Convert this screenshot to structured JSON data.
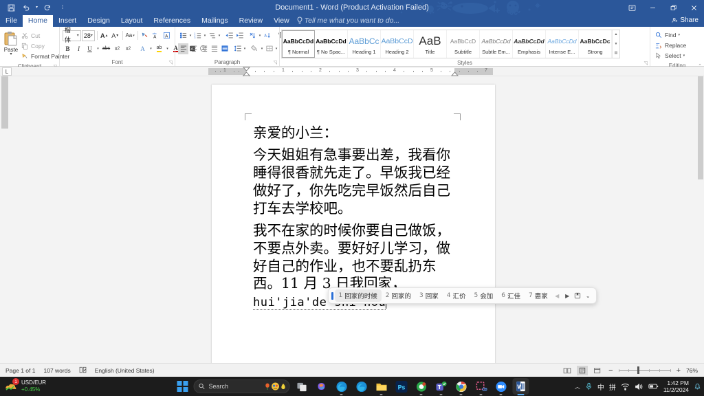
{
  "window": {
    "title": "Document1 - Word (Product Activation Failed)",
    "quick_access": [
      {
        "name": "save-icon",
        "label": "Save"
      },
      {
        "name": "undo-icon",
        "label": "Undo"
      },
      {
        "name": "redo-icon",
        "label": "Redo"
      },
      {
        "name": "customize-qat-icon",
        "label": "Customize Quick Access Toolbar"
      }
    ],
    "controls": [
      {
        "name": "ribbon-display-options-button",
        "glyph": "⬒"
      },
      {
        "name": "minimize-button",
        "glyph": "—"
      },
      {
        "name": "restore-button",
        "glyph": "❐"
      },
      {
        "name": "close-button",
        "glyph": "✕"
      }
    ]
  },
  "tabs": [
    {
      "label": "File",
      "active": false
    },
    {
      "label": "Home",
      "active": true
    },
    {
      "label": "Insert",
      "active": false
    },
    {
      "label": "Design",
      "active": false
    },
    {
      "label": "Layout",
      "active": false
    },
    {
      "label": "References",
      "active": false
    },
    {
      "label": "Mailings",
      "active": false
    },
    {
      "label": "Review",
      "active": false
    },
    {
      "label": "View",
      "active": false
    }
  ],
  "tell_me": "Tell me what you want to do...",
  "share_label": "Share",
  "ribbon": {
    "clipboard": {
      "label": "Clipboard",
      "paste": "Paste",
      "items": [
        {
          "label": "Cut",
          "icon": "scissors-icon"
        },
        {
          "label": "Copy",
          "icon": "copy-icon"
        },
        {
          "label": "Format Painter",
          "icon": "format-painter-icon"
        }
      ]
    },
    "font": {
      "label": "Font",
      "font_name": "楷体",
      "font_size": "28",
      "row1": [
        {
          "name": "grow-font-button",
          "glyph": "A˄"
        },
        {
          "name": "shrink-font-button",
          "glyph": "A˅"
        },
        {
          "name": "change-case-button",
          "glyph": "Aa"
        },
        {
          "name": "clear-formatting-button",
          "glyph": "✐"
        },
        {
          "name": "phonetic-guide-button",
          "glyph": "嵜"
        },
        {
          "name": "character-border-button",
          "glyph": "A"
        }
      ],
      "row2": [
        {
          "name": "bold-button",
          "glyph": "B"
        },
        {
          "name": "italic-button",
          "glyph": "I"
        },
        {
          "name": "underline-button",
          "glyph": "U"
        },
        {
          "name": "strikethrough-button",
          "glyph": "abc"
        },
        {
          "name": "subscript-button",
          "glyph": "x₂"
        },
        {
          "name": "superscript-button",
          "glyph": "x²"
        },
        {
          "name": "text-effects-button",
          "glyph": "A"
        },
        {
          "name": "text-highlight-color-button",
          "glyph": "ab"
        },
        {
          "name": "font-color-button",
          "glyph": "A"
        },
        {
          "name": "character-shading-button",
          "glyph": "A"
        },
        {
          "name": "enclose-characters-button",
          "glyph": "Ⓐ"
        }
      ]
    },
    "paragraph": {
      "label": "Paragraph",
      "row1": [
        {
          "name": "bullets-button",
          "glyph": "≡"
        },
        {
          "name": "numbering-button",
          "glyph": "≣"
        },
        {
          "name": "multilevel-list-button",
          "glyph": "☰"
        },
        {
          "name": "decrease-indent-button",
          "glyph": "⇤"
        },
        {
          "name": "increase-indent-button",
          "glyph": "⇥"
        },
        {
          "name": "sort-button",
          "glyph": "⤨"
        },
        {
          "name": "asian-layout-button",
          "glyph": "⇅"
        },
        {
          "name": "show-formatting-marks-button",
          "glyph": "¶"
        }
      ],
      "row2": [
        {
          "name": "align-left-button",
          "glyph": "☰"
        },
        {
          "name": "align-center-button",
          "glyph": "☰"
        },
        {
          "name": "align-right-button",
          "glyph": "☰"
        },
        {
          "name": "justify-button",
          "glyph": "☰"
        },
        {
          "name": "distributed-button",
          "glyph": "☷"
        },
        {
          "name": "line-spacing-button",
          "glyph": "↕"
        },
        {
          "name": "shading-button",
          "glyph": "▧"
        },
        {
          "name": "borders-button",
          "glyph": "⊞"
        }
      ]
    },
    "styles": {
      "label": "Styles",
      "items": [
        {
          "preview": "AaBbCcDd",
          "name": "¶ Normal",
          "selected": true,
          "style": "normal"
        },
        {
          "preview": "AaBbCcDd",
          "name": "¶ No Spac...",
          "selected": false,
          "style": "nospace"
        },
        {
          "preview": "AaBbCc",
          "name": "Heading 1",
          "selected": false,
          "style": "h1"
        },
        {
          "preview": "AaBbCcD",
          "name": "Heading 2",
          "selected": false,
          "style": "h2"
        },
        {
          "preview": "AaB",
          "name": "Title",
          "selected": false,
          "style": "title"
        },
        {
          "preview": "AaBbCcD",
          "name": "Subtitle",
          "selected": false,
          "style": "subtitle"
        },
        {
          "preview": "AaBbCcDd",
          "name": "Subtle Em...",
          "selected": false,
          "style": "subtleem"
        },
        {
          "preview": "AaBbCcDd",
          "name": "Emphasis",
          "selected": false,
          "style": "emphasis"
        },
        {
          "preview": "AaBbCcDd",
          "name": "Intense E...",
          "selected": false,
          "style": "intense"
        },
        {
          "preview": "AaBbCcDc",
          "name": "Strong",
          "selected": false,
          "style": "strong"
        }
      ]
    },
    "editing": {
      "label": "Editing",
      "items": [
        {
          "label": "Find",
          "icon": "search-icon",
          "caret": true
        },
        {
          "label": "Replace",
          "icon": "replace-icon",
          "caret": false
        },
        {
          "label": "Select",
          "icon": "select-icon",
          "caret": true
        }
      ]
    }
  },
  "ruler": {
    "numbers": [
      "1",
      "1",
      "2",
      "3",
      "4",
      "5",
      "7"
    ],
    "tab_stop_selector": "L"
  },
  "document": {
    "paragraphs": [
      "亲爱的小兰：",
      "今天姐姐有急事要出差，我看你睡得很香就先走了。早饭我已经做好了，你先吃完早饭然后自己打车去学校吧。"
    ],
    "last_paragraph_before_compose": "我不在家的时候你要自己做饭，不要点外卖。要好好儿学习，做好自己的作业，也不要乱扔东西。11 月 3 日我回家，",
    "compose_text": "hui'jia'de'shi'hou"
  },
  "ime": {
    "candidates": [
      {
        "index": "1",
        "text": "回家的时候",
        "selected": true
      },
      {
        "index": "2",
        "text": "回家的",
        "selected": false
      },
      {
        "index": "3",
        "text": "回家",
        "selected": false
      },
      {
        "index": "4",
        "text": "汇价",
        "selected": false
      },
      {
        "index": "5",
        "text": "会加",
        "selected": false
      },
      {
        "index": "6",
        "text": "汇佳",
        "selected": false
      },
      {
        "index": "7",
        "text": "惠家",
        "selected": false
      }
    ],
    "controls": [
      {
        "name": "ime-prev-page-button",
        "glyph": "◀",
        "enabled": false
      },
      {
        "name": "ime-next-page-button",
        "glyph": "▶",
        "enabled": true
      },
      {
        "name": "ime-pin-button",
        "glyph": "☰",
        "enabled": true
      },
      {
        "name": "ime-expand-button",
        "glyph": "∨",
        "enabled": true
      }
    ]
  },
  "status_bar": {
    "page": "Page 1 of 1",
    "words": "107 words",
    "proofing_icon": "proofing-icon",
    "language": "English (United States)",
    "views": [
      {
        "name": "read-mode-button",
        "active": false
      },
      {
        "name": "print-layout-button",
        "active": true
      },
      {
        "name": "web-layout-button",
        "active": false
      }
    ],
    "zoom_out": "−",
    "zoom_in": "+",
    "zoom_level": "76%"
  },
  "taskbar": {
    "widget": {
      "title": "USD/EUR",
      "change": "+0.45%",
      "badge": "1"
    },
    "search_placeholder": "Search",
    "apps": [
      {
        "name": "taskbar-start-button",
        "label": "Start"
      },
      {
        "name": "taskbar-search",
        "label": "Search"
      },
      {
        "name": "taskbar-task-view-button",
        "label": "Task View"
      },
      {
        "name": "taskbar-copilot-button",
        "label": "Copilot"
      },
      {
        "name": "taskbar-edge-button",
        "label": "Microsoft Edge"
      },
      {
        "name": "taskbar-edge2-button",
        "label": "Microsoft Edge"
      },
      {
        "name": "taskbar-file-explorer-button",
        "label": "File Explorer"
      },
      {
        "name": "taskbar-photoshop-button",
        "label": "Ps"
      },
      {
        "name": "taskbar-chrome-app-button",
        "label": "App"
      },
      {
        "name": "taskbar-teams-button",
        "label": "Microsoft Teams"
      },
      {
        "name": "taskbar-chrome-button",
        "label": "Google Chrome"
      },
      {
        "name": "taskbar-snipping-tool-button",
        "label": "Snipping Tool"
      },
      {
        "name": "taskbar-zoom-button",
        "label": "Zoom"
      },
      {
        "name": "taskbar-word-button",
        "label": "Word"
      }
    ],
    "tray": {
      "chevron": "⌃",
      "mic": "mic-icon",
      "ime_mode": "中",
      "ime_pinyin": "拼",
      "wifi": "wifi-icon",
      "volume": "volume-icon",
      "battery": "battery-icon",
      "time": "1:42 PM",
      "date": "11/2/2024",
      "notification": "bell-icon"
    }
  },
  "colors": {
    "word_blue": "#2b579a",
    "accent_blue": "#2b6fd6",
    "taskbar_bg": "#1c1c1c",
    "status_bg": "#f1f1f1"
  }
}
